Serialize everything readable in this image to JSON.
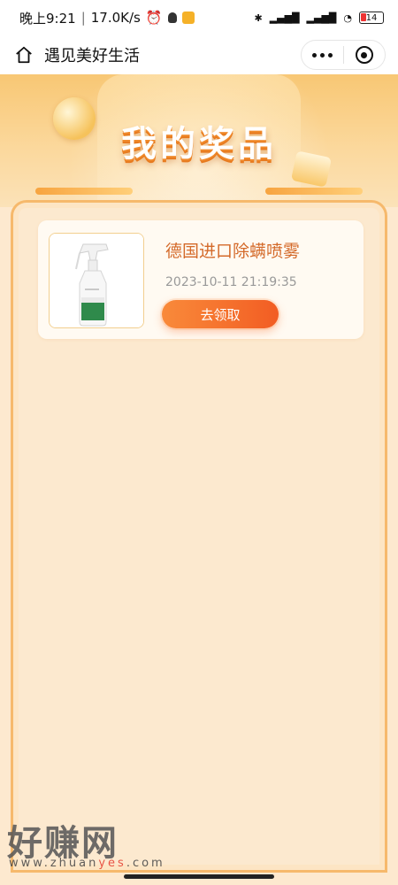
{
  "status_bar": {
    "time": "晚上9:21",
    "speed": "17.0K/s",
    "battery": "14"
  },
  "navbar": {
    "title": "遇见美好生活"
  },
  "banner": {
    "title": "我的奖品"
  },
  "prizes": [
    {
      "name": "德国进口除螨喷雾",
      "time": "2023-10-11 21:19:35",
      "button_label": "去领取"
    }
  ],
  "watermark": {
    "text": "好赚网",
    "url_prefix": "www.zhuan",
    "url_highlight": "yes",
    "url_suffix": ".com"
  },
  "colors": {
    "accent": "#f25d23",
    "prize_name": "#d46a2a",
    "panel_bg": "#fce9cf"
  }
}
